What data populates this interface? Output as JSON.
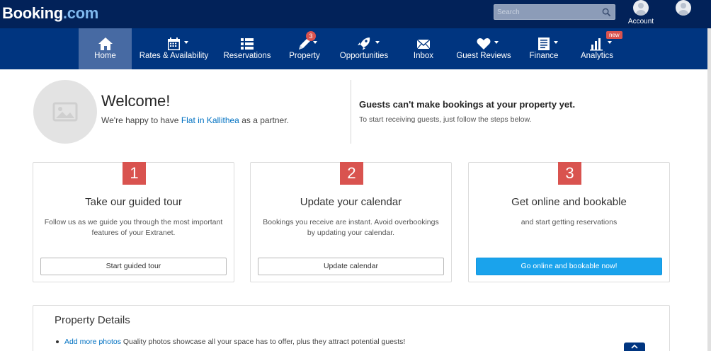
{
  "header": {
    "logo_main": "Booking",
    "logo_suffix": ".com",
    "search_placeholder": "Search",
    "account_label": "Account"
  },
  "nav": {
    "items": [
      {
        "label": "Home",
        "icon": "home-icon"
      },
      {
        "label": "Rates & Availability",
        "icon": "calendar-icon"
      },
      {
        "label": "Reservations",
        "icon": "list-icon"
      },
      {
        "label": "Property",
        "icon": "pencil-icon",
        "badge": "3"
      },
      {
        "label": "Opportunities",
        "icon": "rocket-icon"
      },
      {
        "label": "Inbox",
        "icon": "envelope-icon"
      },
      {
        "label": "Guest Reviews",
        "icon": "heart-icon"
      },
      {
        "label": "Finance",
        "icon": "document-icon"
      },
      {
        "label": "Analytics",
        "icon": "bar-chart-icon",
        "tag": "new"
      }
    ]
  },
  "welcome": {
    "title": "Welcome!",
    "sub_before": "We're happy to have ",
    "property_link": "Flat in Kallithea",
    "sub_after": " as a partner."
  },
  "guests": {
    "title": "Guests can't make bookings at your property yet.",
    "subtitle": "To start receiving guests, just follow the steps below."
  },
  "steps": [
    {
      "number": "1",
      "title": "Take our guided tour",
      "description": "Follow us as we guide you through the most important features of your Extranet.",
      "button": "Start guided tour"
    },
    {
      "number": "2",
      "title": "Update your calendar",
      "description": "Bookings you receive are instant. Avoid overbookings by updating your calendar.",
      "button": "Update calendar"
    },
    {
      "number": "3",
      "title": "Get online and bookable",
      "description": "and start getting reservations",
      "button": "Go online and bookable now!"
    }
  ],
  "property_details": {
    "title": "Property Details",
    "item_link": "Add more photos",
    "item_text": " Quality photos showcase all your space has to offer, plus they attract potential guests!"
  },
  "colors": {
    "topbar": "#022259",
    "nav": "#003580",
    "nav_active": "#476aa3",
    "step_badge": "#d9534f",
    "primary_button": "#1aa3ec",
    "link": "#0071c2"
  }
}
